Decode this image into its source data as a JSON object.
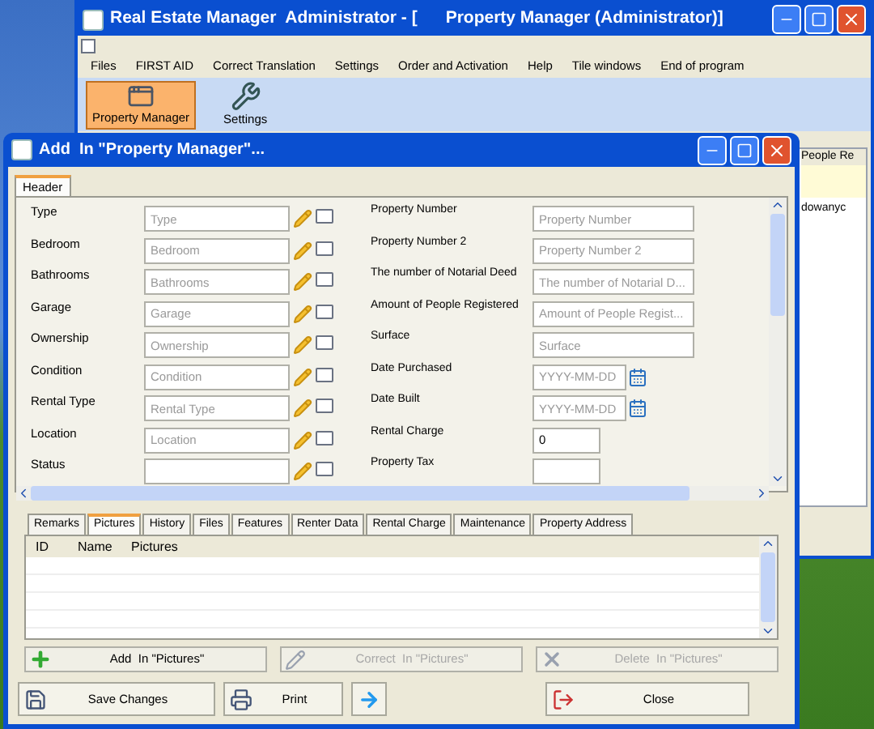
{
  "main_window": {
    "title": "Real Estate Manager  Administrator - [      Property Manager (Administrator)]",
    "menu": [
      "Files",
      "FIRST AID",
      "Correct Translation",
      "Settings",
      "Order and Activation",
      "Help",
      "Tile windows",
      "End of program"
    ],
    "toolbar": [
      {
        "label": "Property Manager",
        "selected": true,
        "kind": "window"
      },
      {
        "label": "Settings",
        "selected": false,
        "kind": "tools"
      }
    ],
    "background_grid": {
      "column_header": "People Re",
      "cell": "dowanyc"
    }
  },
  "dialog": {
    "title": "Add  In \"Property Manager\"...",
    "tabs": [
      {
        "label": "Header",
        "selected": true
      }
    ],
    "fields_left": [
      {
        "label": "Type",
        "placeholder": "Type"
      },
      {
        "label": "Bedroom",
        "placeholder": "Bedroom"
      },
      {
        "label": "Bathrooms",
        "placeholder": "Bathrooms"
      },
      {
        "label": "Garage",
        "placeholder": "Garage"
      },
      {
        "label": "Ownership",
        "placeholder": "Ownership"
      },
      {
        "label": "Condition",
        "placeholder": "Condition"
      },
      {
        "label": "Rental Type",
        "placeholder": "Rental Type"
      },
      {
        "label": "Location",
        "placeholder": "Location"
      },
      {
        "label": "Status"
      }
    ],
    "fields_right": [
      {
        "label": "Property Number",
        "kind": "text",
        "placeholder": "Property Number"
      },
      {
        "label": "Property Number 2",
        "kind": "text",
        "placeholder": "Property Number 2"
      },
      {
        "label": "The number of Notarial Deed",
        "kind": "text",
        "placeholder": "The number of Notarial D..."
      },
      {
        "label": "Amount of People Registered",
        "kind": "text",
        "placeholder": "Amount of People Regist..."
      },
      {
        "label": "Surface",
        "kind": "text",
        "placeholder": "Surface"
      },
      {
        "label": "Date Purchased",
        "kind": "date",
        "placeholder": "YYYY-MM-DD"
      },
      {
        "label": "Date Built",
        "kind": "date",
        "placeholder": "YYYY-MM-DD"
      },
      {
        "label": "Rental Charge",
        "kind": "number",
        "value": "0"
      },
      {
        "label": "Property Tax",
        "kind": "number"
      }
    ],
    "detail_tabs": [
      {
        "label": "Remarks",
        "selected": false
      },
      {
        "label": "Pictures",
        "selected": true
      },
      {
        "label": "History",
        "selected": false
      },
      {
        "label": "Files",
        "selected": false
      },
      {
        "label": "Features",
        "selected": false
      },
      {
        "label": "Renter Data",
        "selected": false
      },
      {
        "label": "Rental Charge",
        "selected": false
      },
      {
        "label": "Maintenance",
        "selected": false
      },
      {
        "label": "Property Address",
        "selected": false
      }
    ],
    "table": {
      "columns": [
        "ID",
        "Name",
        "Pictures"
      ]
    },
    "actions": [
      {
        "label": "Add  In \"Pictures\"",
        "kind": "add",
        "disabled": false
      },
      {
        "label": "Correct  In \"Pictures\"",
        "kind": "edit",
        "disabled": true
      },
      {
        "label": "Delete  In \"Pictures\"",
        "kind": "delete",
        "disabled": true
      }
    ],
    "footer": [
      {
        "label": "Save Changes",
        "kind": "save"
      },
      {
        "label": "Print",
        "kind": "print"
      },
      {
        "kind": "next"
      },
      {
        "label": "Close",
        "kind": "close"
      }
    ]
  }
}
